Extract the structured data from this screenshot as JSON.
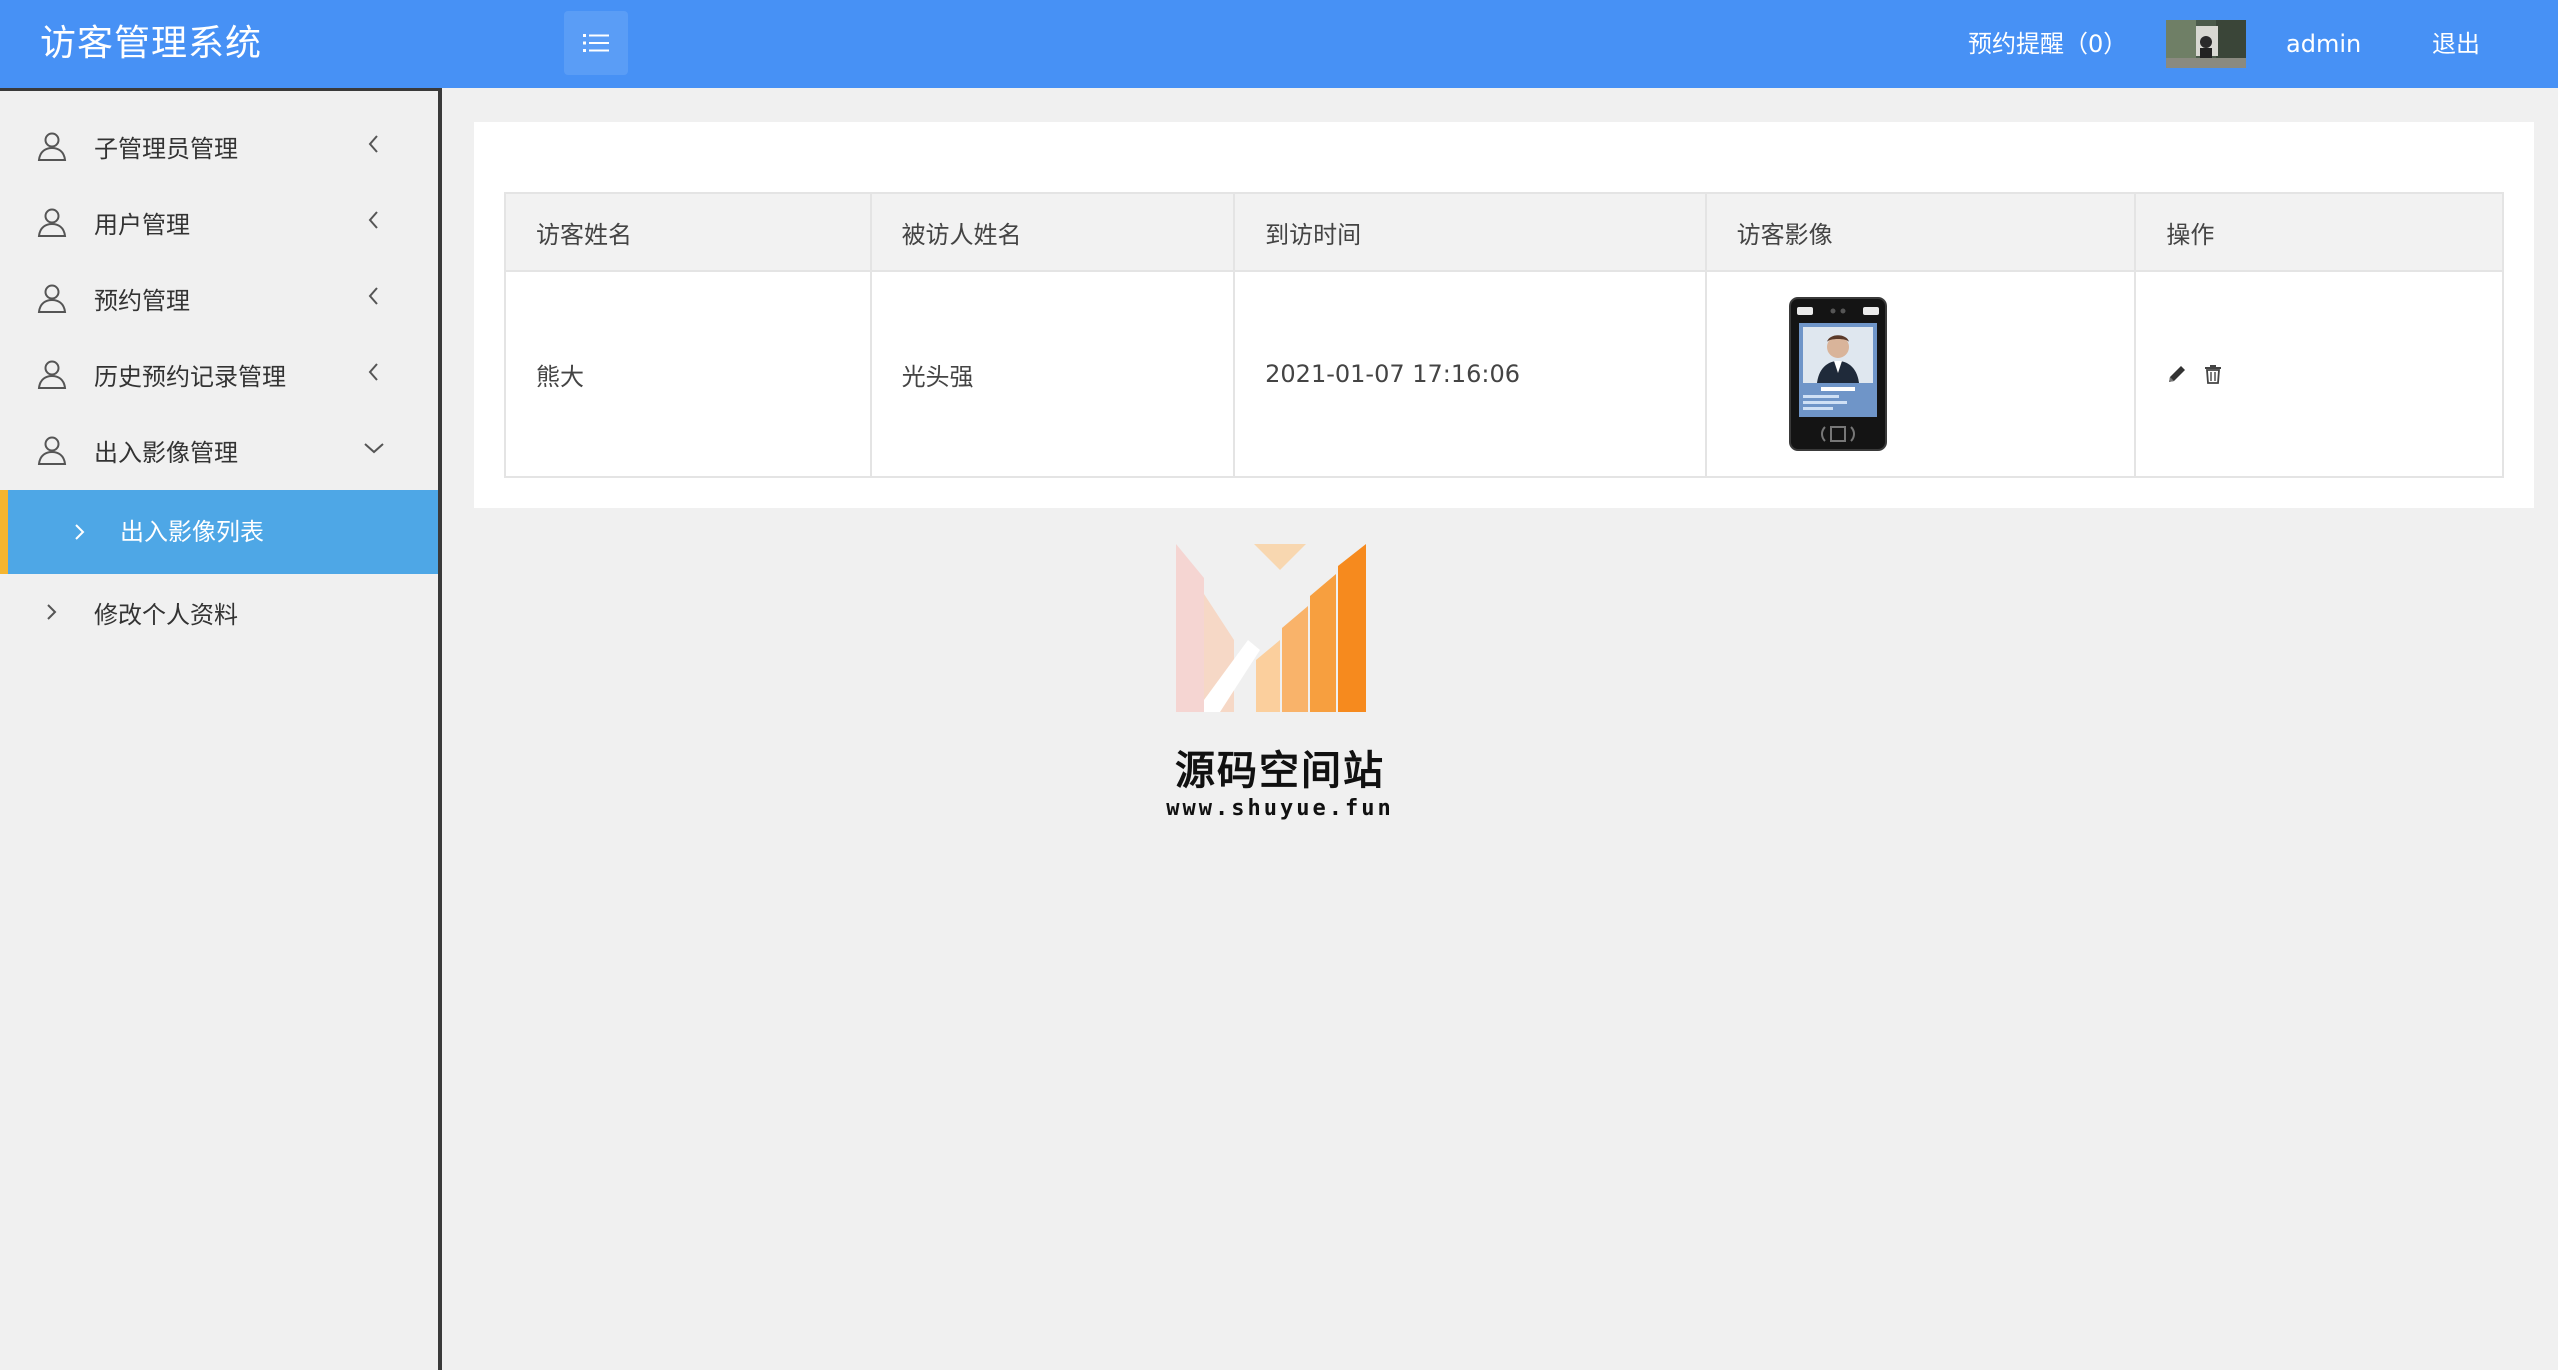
{
  "header": {
    "title": "访客管理系统",
    "reminder_label": "预约提醒（0）",
    "username": "admin",
    "logout_label": "退出"
  },
  "sidebar": {
    "items": [
      {
        "label": "子管理员管理",
        "icon": "user-icon",
        "state": "collapsed"
      },
      {
        "label": "用户管理",
        "icon": "user-icon",
        "state": "collapsed"
      },
      {
        "label": "预约管理",
        "icon": "user-icon",
        "state": "collapsed"
      },
      {
        "label": "历史预约记录管理",
        "icon": "user-icon",
        "state": "collapsed"
      },
      {
        "label": "出入影像管理",
        "icon": "user-icon",
        "state": "expanded"
      }
    ],
    "active_subitem": {
      "label": "出入影像列表"
    },
    "bottom_item": {
      "label": "修改个人资料"
    },
    "colors": {
      "active_bg": "#4ea7e6",
      "active_marker": "#f5b530"
    }
  },
  "table": {
    "columns": [
      "访客姓名",
      "被访人姓名",
      "到访时间",
      "访客影像",
      "操作"
    ],
    "rows": [
      {
        "visitor": "熊大",
        "host": "光头强",
        "time": "2021-01-07 17:16:06",
        "image_icon": "face-recognition-device-image",
        "actions": [
          "edit-icon",
          "delete-icon"
        ]
      }
    ]
  },
  "watermark": {
    "title": "源码空间站",
    "url": "www.shuyue.fun"
  },
  "colors": {
    "header_bg": "#4791f5",
    "page_bg": "#f0f0f0"
  }
}
